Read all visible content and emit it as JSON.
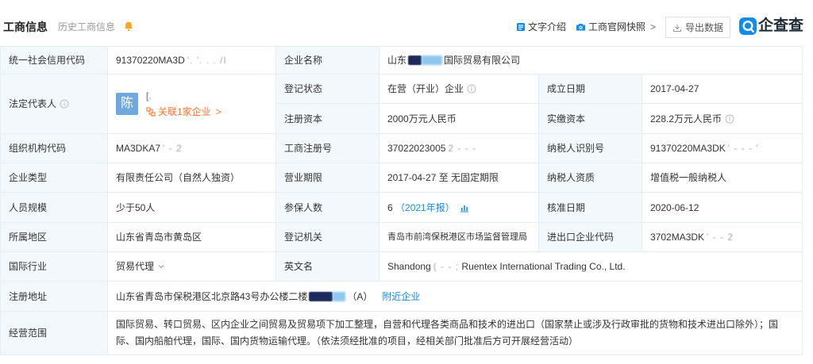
{
  "header": {
    "title": "工商信息",
    "history_link": "历史工商信息",
    "actions": {
      "text_intro": "文字介绍",
      "official_snapshot": "工商官网快照",
      "snapshot_chevron": ">",
      "export": "导出数据"
    },
    "logo_text": "企查查"
  },
  "icons": {
    "bell": "bell-icon",
    "text_intro": "document-icon",
    "snapshot": "camera-icon",
    "export": "download-icon",
    "logo": "qcc-logo-icon",
    "info": "info-icon",
    "related": "link-icon",
    "annual_report_chart": "bar-chart-icon",
    "industry_dropdown": "chevron-down-icon"
  },
  "colors": {
    "accent": "#128bed",
    "orange": "#ff722d",
    "label_bg": "#f3f8fd",
    "border": "#e4eef6",
    "text": "#333333",
    "muted": "#999999",
    "avatar_bg": "#6fa8dc",
    "bell": "#f5a623"
  },
  "rows": {
    "credit_code": {
      "label": "统一社会信用代码",
      "value": "91370220MA3D",
      "masked": "'. '. . . /I"
    },
    "company_name": {
      "label": "企业名称",
      "value_prefix": "山东",
      "value_suffix": "国际贸易有限公司"
    },
    "legal_rep": {
      "label": "法定代表人",
      "avatar": "陈",
      "name_masked": "[.",
      "related": "关联1家企业",
      "related_chevron": ">"
    },
    "reg_status": {
      "label": "登记状态",
      "value": "在营（开业）企业"
    },
    "founded": {
      "label": "成立日期",
      "value": "2017-04-27"
    },
    "reg_capital": {
      "label": "注册资本",
      "value": "2000万元人民币"
    },
    "paid_capital": {
      "label": "实缴资本",
      "value": "228.2万元人民币"
    },
    "org_code": {
      "label": "组织机构代码",
      "value": "MA3DKA7",
      "masked": "' - 2"
    },
    "reg_number": {
      "label": "工商注册号",
      "value": "37022023005",
      "masked": "2 - - -"
    },
    "taxpayer_id": {
      "label": "纳税人识别号",
      "value": "91370220MA3DK",
      "masked": "' - - - '"
    },
    "company_type": {
      "label": "企业类型",
      "value": "有限责任公司（自然人独资）"
    },
    "business_term": {
      "label": "营业期限",
      "value": "2017-04-27 至 无固定期限"
    },
    "taxpayer_qual": {
      "label": "纳税人资质",
      "value": "增值税一般纳税人"
    },
    "staff_size": {
      "label": "人员规模",
      "value": "少于50人"
    },
    "insured": {
      "label": "参保人数",
      "value": "6",
      "report_link": "（2021年报）"
    },
    "approval_date": {
      "label": "核准日期",
      "value": "2020-06-12"
    },
    "region": {
      "label": "所属地区",
      "value": "山东省青岛市黄岛区"
    },
    "reg_authority": {
      "label": "登记机关",
      "value": "青岛市前湾保税港区市场监督管理局"
    },
    "import_export_code": {
      "label": "进出口企业代码",
      "value": "3702MA3DK",
      "masked": "' - - 2"
    },
    "industry": {
      "label": "国际行业",
      "value": "贸易代理"
    },
    "english_name": {
      "label": "英文名",
      "value_prefix": "Shandong",
      "masked": "( - - ;",
      "value_suffix": "Ruentex International Trading Co., Ltd."
    },
    "address": {
      "label": "注册地址",
      "value_prefix": "山东省青岛市保税港区北京路43号办公楼二楼",
      "value_suffix": "（A）",
      "nearby_link": "附近企业"
    },
    "business_scope": {
      "label": "经营范围",
      "value": "国际贸易、转口贸易、区内企业之间贸易及贸易项下加工整理，自营和代理各类商品和技术的进出口（国家禁止或涉及行政审批的货物和技术进出口除外）；国际、国内船舶代理，国际、国内货物运输代理。（依法须经批准的项目，经相关部门批准后方可开展经营活动）"
    }
  }
}
